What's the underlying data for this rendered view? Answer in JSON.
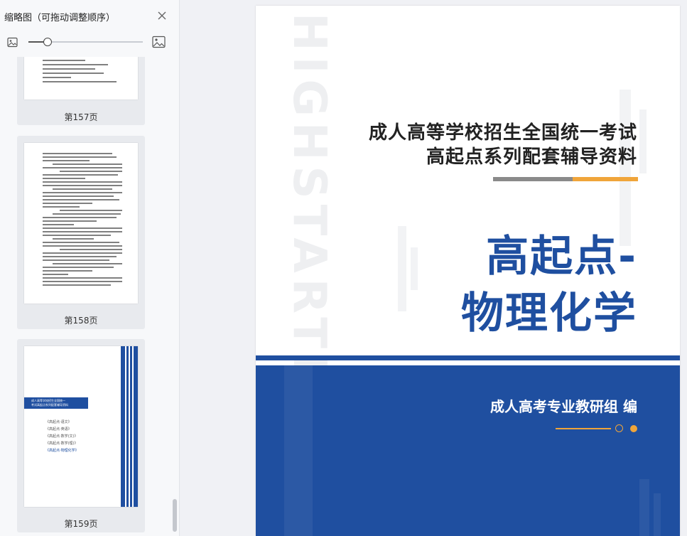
{
  "sidebar": {
    "title": "缩略图（可拖动调整顺序）",
    "close_icon": "close-icon",
    "zoom": {
      "small_icon": "image-small-icon",
      "large_icon": "image-large-icon",
      "level": 0.17
    },
    "thumbnails": [
      {
        "label": "第157页"
      },
      {
        "label": "第158页"
      },
      {
        "label": "第159页",
        "banner_line1": "成人高等学校招生全国统一",
        "banner_line2": "考试高起点系列配套辅导资料",
        "list": [
          "《高起点·语文》",
          "《高起点·英语》",
          "《高起点·数学(文)》",
          "《高起点·数学(理)》",
          "《高起点·物理化学》"
        ]
      }
    ]
  },
  "document": {
    "vertical_text": "HIGHSTARTING",
    "subtitle_line1": "成人高等学校招生全国统一考试",
    "subtitle_line2": "高起点系列配套辅导资料",
    "title_line1": "高起点-",
    "title_line2": "物理化学",
    "author": "成人高考专业教研组 编"
  },
  "colors": {
    "brand_blue": "#1f4fa0",
    "accent_orange": "#f0a53a"
  }
}
